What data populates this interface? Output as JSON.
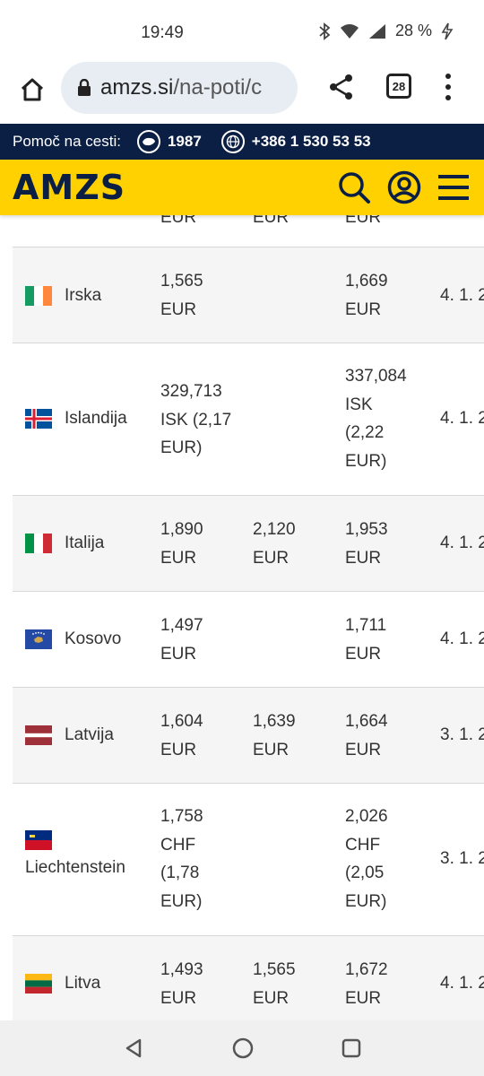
{
  "status_bar": {
    "time": "19:49",
    "battery": "28 %"
  },
  "browser": {
    "url_host": "amzs.si",
    "url_path": "/na-poti/c",
    "tab_count": "28"
  },
  "help_bar": {
    "label": "Pomoč na cesti:",
    "phone_short": "1987",
    "phone_intl": "+386 1 530 53 53"
  },
  "brand": {
    "logo": "AMZS"
  },
  "table": {
    "partial_top": {
      "c1": "EUR",
      "c2": "EUR",
      "c3": "EUR"
    },
    "rows": [
      {
        "country": "Irska",
        "flag": "ireland-flag",
        "c1": "1,565\nEUR",
        "c2": "",
        "c3": "1,669\nEUR",
        "date": "4. 1. 2"
      },
      {
        "country": "Islandija",
        "flag": "iceland-flag",
        "c1": "329,713\nISK (2,17\nEUR)",
        "c2": "",
        "c3": "337,084\nISK\n(2,22\nEUR)",
        "date": "4. 1. 2"
      },
      {
        "country": "Italija",
        "flag": "italy-flag",
        "c1": "1,890\nEUR",
        "c2": "2,120\nEUR",
        "c3": "1,953\nEUR",
        "date": "4. 1. 2"
      },
      {
        "country": "Kosovo",
        "flag": "kosovo-flag",
        "c1": "1,497\nEUR",
        "c2": "",
        "c3": "1,711\nEUR",
        "date": "4. 1. 2"
      },
      {
        "country": "Latvija",
        "flag": "latvia-flag",
        "c1": "1,604\nEUR",
        "c2": "1,639\nEUR",
        "c3": "1,664\nEUR",
        "date": "3. 1. 2"
      },
      {
        "country": "Liechtenstein",
        "flag": "liechtenstein-flag",
        "c1": "1,758\nCHF\n(1,78\nEUR)",
        "c2": "",
        "c3": "2,026\nCHF\n(2,05\nEUR)",
        "date": "3. 1. 2"
      },
      {
        "country": "Litva",
        "flag": "lithuania-flag",
        "c1": "1,493\nEUR",
        "c2": "1,565\nEUR",
        "c3": "1,672\nEUR",
        "date": "4. 1. 2"
      }
    ]
  },
  "colors": {
    "brand_yellow": "#ffd100",
    "brand_navy": "#0b1f45"
  }
}
